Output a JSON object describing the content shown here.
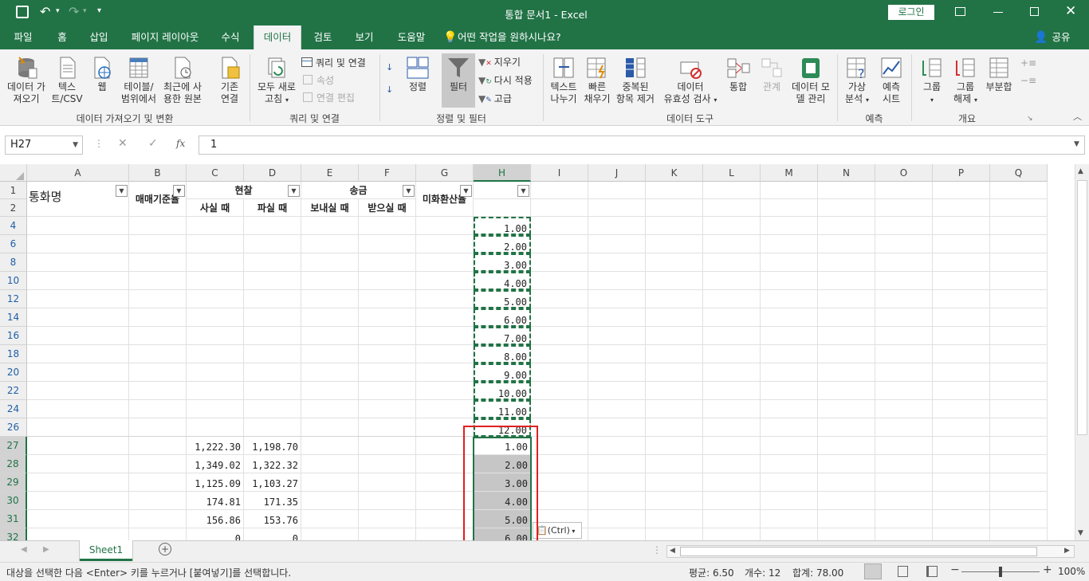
{
  "title": {
    "app_title": "통합 문서1  -  Excel",
    "login": "로그인"
  },
  "tabs": [
    "파일",
    "홈",
    "삽입",
    "페이지 레이아웃",
    "수식",
    "데이터",
    "검토",
    "보기",
    "도움말"
  ],
  "tell_me": "어떤 작업을 원하시나요?",
  "share": "공유",
  "ribbon": {
    "get_data": "데이터 가\n져오기",
    "text_csv": "텍스\n트/CSV",
    "web": "웹",
    "table_range": "테이블/\n범위에서",
    "recent": "최근에 사\n용한 원본",
    "existing": "기존\n연결",
    "refresh_all": "모두 새로\n고침",
    "queries": "쿼리 및 연결",
    "properties": "속성",
    "edit_links": "연결 편집",
    "sort": "정렬",
    "filter": "필터",
    "clear": "지우기",
    "reapply": "다시 적용",
    "advanced": "고급",
    "text_to_col": "텍스트\n나누기",
    "flash_fill": "빠른\n채우기",
    "remove_dup": "중복된\n항목 제거",
    "validation": "데이터\n유효성 검사",
    "consolidate": "통합",
    "relations": "관계",
    "data_model": "데이터 모\n델 관리",
    "whatif": "가상\n분석",
    "forecast": "예측\n시트",
    "group": "그룹",
    "ungroup": "그룹\n해제",
    "subtotal": "부분합",
    "grp_get": "데이터 가져오기 및 변환",
    "grp_query": "쿼리 및 연결",
    "grp_sort": "정렬 및 필터",
    "grp_tools": "데이터 도구",
    "grp_forecast": "예측",
    "grp_outline": "개요"
  },
  "formula_bar": {
    "name_box": "H27",
    "formula": "1",
    "fx": "fx"
  },
  "columns": [
    "A",
    "B",
    "C",
    "D",
    "E",
    "F",
    "G",
    "H",
    "I",
    "J",
    "K",
    "L",
    "M",
    "N",
    "O",
    "P",
    "Q"
  ],
  "header_cells": {
    "a1": "통화명",
    "b1": "매매기준율",
    "cd1": "현찰",
    "ef1": "송금",
    "g1": "미화환산율",
    "c2": "사실 때",
    "d2": "파실 때",
    "e2": "보내실 때",
    "f2": "받으실 때"
  },
  "rows": [
    {
      "n": "1",
      "c": "",
      "d": "",
      "h": ""
    },
    {
      "n": "2",
      "c": "",
      "d": "",
      "h": ""
    },
    {
      "n": "4",
      "c": "",
      "d": "",
      "h": "1.00"
    },
    {
      "n": "6",
      "c": "",
      "d": "",
      "h": "2.00"
    },
    {
      "n": "8",
      "c": "",
      "d": "",
      "h": "3.00"
    },
    {
      "n": "10",
      "c": "",
      "d": "",
      "h": "4.00"
    },
    {
      "n": "12",
      "c": "",
      "d": "",
      "h": "5.00"
    },
    {
      "n": "14",
      "c": "",
      "d": "",
      "h": "6.00"
    },
    {
      "n": "16",
      "c": "",
      "d": "",
      "h": "7.00"
    },
    {
      "n": "18",
      "c": "",
      "d": "",
      "h": "8.00"
    },
    {
      "n": "20",
      "c": "",
      "d": "",
      "h": "9.00"
    },
    {
      "n": "22",
      "c": "",
      "d": "",
      "h": "10.00"
    },
    {
      "n": "24",
      "c": "",
      "d": "",
      "h": "11.00"
    },
    {
      "n": "26",
      "c": "",
      "d": "",
      "h": "12.00"
    },
    {
      "n": "27",
      "c": "1,222.30",
      "d": "1,198.70",
      "h": "1.00"
    },
    {
      "n": "28",
      "c": "1,349.02",
      "d": "1,322.32",
      "h": "2.00"
    },
    {
      "n": "29",
      "c": "1,125.09",
      "d": "1,103.27",
      "h": "3.00"
    },
    {
      "n": "30",
      "c": "174.81",
      "d": "171.35",
      "h": "4.00"
    },
    {
      "n": "31",
      "c": "156.86",
      "d": "153.76",
      "h": "5.00"
    },
    {
      "n": "32",
      "c": "0",
      "d": "0",
      "h": "6.00"
    }
  ],
  "paste_options": "(Ctrl)",
  "sheet_tab": "Sheet1",
  "status": {
    "message": "대상을 선택한 다음 <Enter> 키를 누르거나 [붙여넣기]를 선택합니다.",
    "average": "평균: 6.50",
    "count": "개수: 12",
    "sum": "합계: 78.00",
    "zoom": "100%",
    "zoom_level": 0.5
  },
  "colors": {
    "brand": "#217346",
    "selection": "#c6c6c6",
    "highlight": "#e02020"
  }
}
